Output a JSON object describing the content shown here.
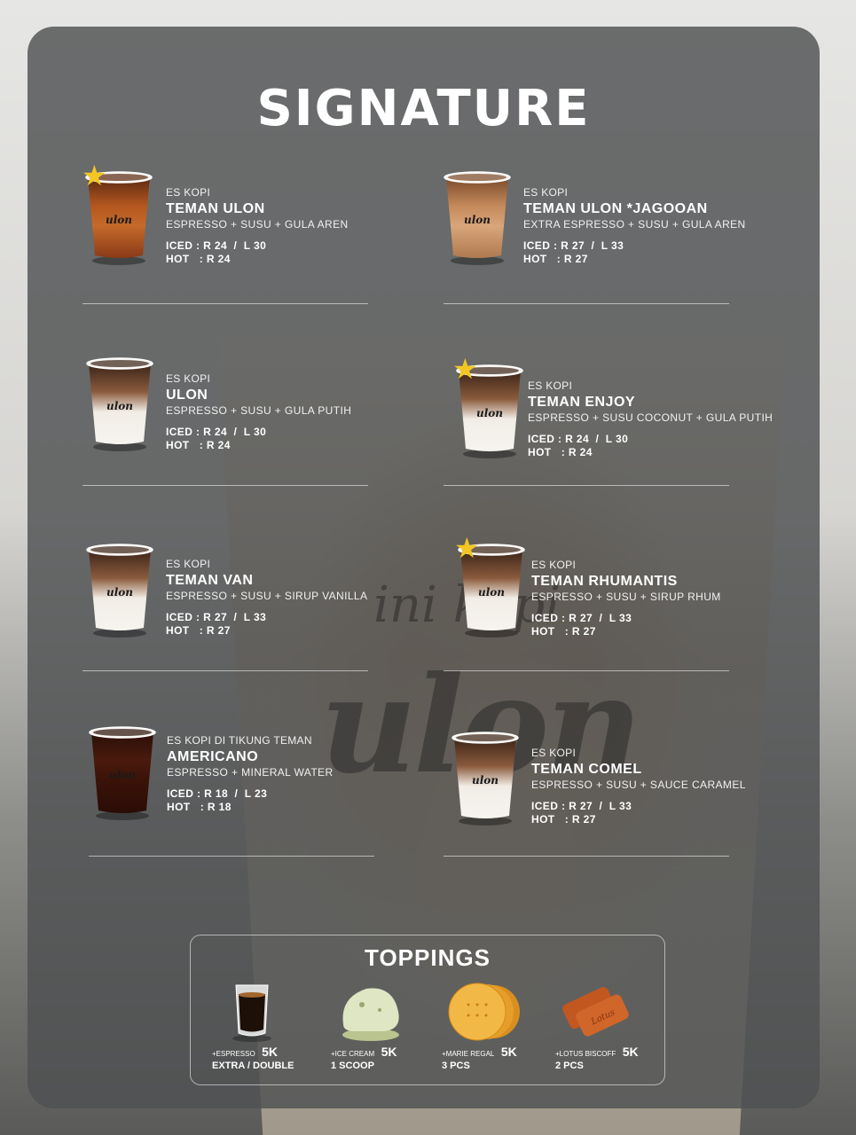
{
  "title": "SIGNATURE",
  "items": [
    {
      "cat": "ES KOPI",
      "name": "TEMAN ULON",
      "desc": "ESPRESSO + SUSU + GULA AREN",
      "iced": "ICED : R 24  /  L 30",
      "hot": "HOT   : R 24",
      "cup": "caramel",
      "star": true
    },
    {
      "cat": "ES KOPI",
      "name": "TEMAN ULON *JAGOOAN",
      "desc": "EXTRA ESPRESSO + SUSU + GULA AREN",
      "iced": "ICED : R 27  /  L 33",
      "hot": "HOT   : R 27",
      "cup": "latte-brown",
      "star": false
    },
    {
      "cat": "ES KOPI",
      "name": "ULON",
      "desc": "ESPRESSO + SUSU + GULA PUTIH",
      "iced": "ICED : R 24  /  L 30",
      "hot": "HOT   : R 24",
      "cup": "milk",
      "star": false
    },
    {
      "cat": "ES KOPI",
      "name": "TEMAN ENJOY",
      "desc": "ESPRESSO + SUSU COCONUT + GULA PUTIH",
      "iced": "ICED : R 24  /  L 30",
      "hot": "HOT   : R 24",
      "cup": "milk",
      "star": true
    },
    {
      "cat": "ES KOPI",
      "name": "TEMAN VAN",
      "desc": "ESPRESSO + SUSU + SIRUP VANILLA",
      "iced": "ICED : R 27  /  L 33",
      "hot": "HOT   : R 27",
      "cup": "milk",
      "star": false
    },
    {
      "cat": "ES KOPI",
      "name": "TEMAN RHUMANTIS",
      "desc": "ESPRESSO + SUSU + SIRUP RHUM",
      "iced": "ICED : R 27  /  L 33",
      "hot": "HOT   : R 27",
      "cup": "milk",
      "star": true
    },
    {
      "cat": "ES KOPI DI TIKUNG TEMAN",
      "name": "AMERICANO",
      "desc": "ESPRESSO + MINERAL WATER",
      "iced": "ICED : R 18  /  L 23",
      "hot": "HOT   : R 18",
      "cup": "black",
      "star": false
    },
    {
      "cat": "ES KOPI",
      "name": "TEMAN COMEL",
      "desc": "ESPRESSO + SUSU + SAUCE CARAMEL",
      "iced": "ICED : R 27  /  L 33",
      "hot": "HOT   : R 27",
      "cup": "milk",
      "star": false
    }
  ],
  "cup_logo": "ulon",
  "background_logo": {
    "small": "ini kopi",
    "big": "ulon"
  },
  "toppings": {
    "title": "TOPPINGS",
    "items": [
      {
        "label": "+ESPRESSO",
        "price": "5K",
        "sub": "EXTRA / DOUBLE",
        "icon": "espresso-shot-icon"
      },
      {
        "label": "+ICE CREAM",
        "price": "5K",
        "sub": "1 SCOOP",
        "icon": "ice-cream-scoop-icon"
      },
      {
        "label": "+MARIE REGAL",
        "price": "5K",
        "sub": "3 PCS",
        "icon": "marie-biscuit-icon"
      },
      {
        "label": "+LOTUS BISCOFF",
        "price": "5K",
        "sub": "2 PCS",
        "icon": "lotus-biscoff-icon"
      }
    ]
  },
  "colors": {
    "panel": "#4e5052",
    "star": "#f3c623",
    "text": "#ffffff"
  }
}
